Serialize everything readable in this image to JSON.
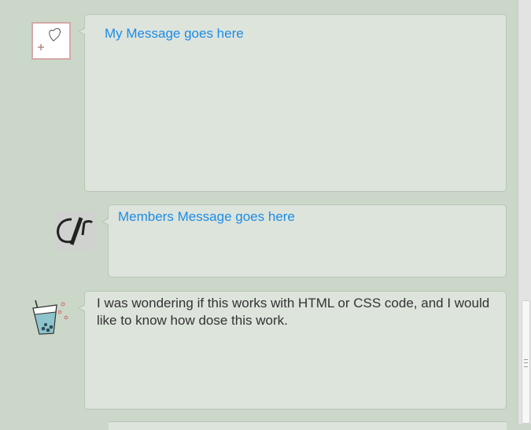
{
  "messages": [
    {
      "avatar": "heart-outline-icon",
      "text": "My Message goes here",
      "style": "link"
    },
    {
      "avatar": "stylized-logo-icon",
      "text": "Members Message goes here",
      "style": "link"
    },
    {
      "avatar": "bubble-tea-icon",
      "text": "I was wondering if this works with HTML or CSS code, and I would like to know how dose this work.",
      "style": "plain"
    }
  ],
  "colors": {
    "background": "#cbd7c8",
    "bubble": "#dde4dc",
    "link": "#1c8ce6",
    "text": "#333333"
  }
}
